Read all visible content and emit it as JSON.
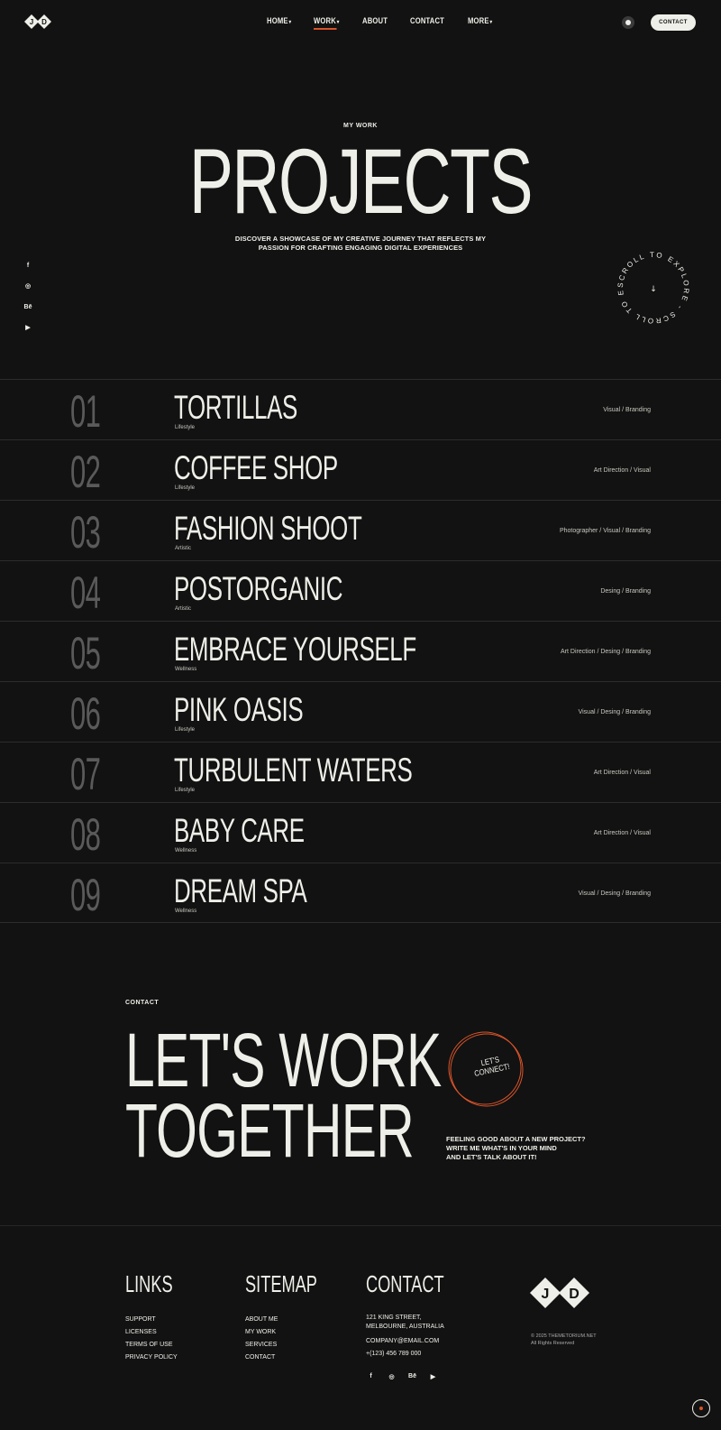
{
  "header": {
    "logo_letters": [
      "J",
      "D"
    ],
    "nav": [
      {
        "label": "HOME",
        "caret": true,
        "active": false
      },
      {
        "label": "WORK",
        "caret": true,
        "active": true
      },
      {
        "label": "ABOUT",
        "caret": false,
        "active": false
      },
      {
        "label": "CONTACT",
        "caret": false,
        "active": false
      },
      {
        "label": "MORE",
        "caret": true,
        "active": false
      }
    ],
    "contact_button": "CONTACT"
  },
  "hero": {
    "eyebrow": "MY WORK",
    "title": "PROJECTS",
    "subtitle_line1": "DISCOVER A SHOWCASE OF MY CREATIVE JOURNEY THAT REFLECTS MY",
    "subtitle_line2": "PASSION FOR CRAFTING ENGAGING DIGITAL EXPERIENCES",
    "scroll_badge_text": "SCROLL TO EXPLORE - SCROLL TO EXPLORE - "
  },
  "social_icons": [
    "f",
    "◎",
    "Bē",
    "▶"
  ],
  "projects": [
    {
      "num": "01",
      "title": "TORTILLAS",
      "category": "Lifestyle",
      "tags": "Visual / Branding"
    },
    {
      "num": "02",
      "title": "COFFEE SHOP",
      "category": "Lifestyle",
      "tags": "Art Direction / Visual"
    },
    {
      "num": "03",
      "title": "FASHION SHOOT",
      "category": "Artistic",
      "tags": "Photographer / Visual / Branding"
    },
    {
      "num": "04",
      "title": "POSTORGANIC",
      "category": "Artistic",
      "tags": "Desing / Branding"
    },
    {
      "num": "05",
      "title": "EMBRACE YOURSELF",
      "category": "Wellness",
      "tags": "Art Direction / Desing / Branding"
    },
    {
      "num": "06",
      "title": "PINK OASIS",
      "category": "Lifestyle",
      "tags": "Visual / Desing / Branding"
    },
    {
      "num": "07",
      "title": "TURBULENT WATERS",
      "category": "Lifestyle",
      "tags": "Art Direction / Visual"
    },
    {
      "num": "08",
      "title": "BABY CARE",
      "category": "Wellness",
      "tags": "Art Direction / Visual"
    },
    {
      "num": "09",
      "title": "DREAM SPA",
      "category": "Wellness",
      "tags": "Visual / Desing / Branding"
    }
  ],
  "contact": {
    "eyebrow": "CONTACT",
    "title_line1": "LET'S WORK",
    "title_line2": "TOGETHER",
    "badge_line1": "LET'S",
    "badge_line2": "CONNECT!",
    "copy_line1": "FEELING GOOD ABOUT A NEW PROJECT?",
    "copy_line2": "WRITE ME WHAT'S IN YOUR MIND",
    "copy_line3": "AND LET'S TALK ABOUT IT!"
  },
  "footer": {
    "links": {
      "heading": "LINKS",
      "items": [
        "SUPPORT",
        "LICENSES",
        "TERMS OF USE",
        "PRIVACY POLICY"
      ]
    },
    "sitemap": {
      "heading": "SITEMAP",
      "items": [
        "ABOUT ME",
        "MY WORK",
        "SERVICES",
        "CONTACT"
      ]
    },
    "contact": {
      "heading": "CONTACT",
      "address_line1": "121 KING STREET,",
      "address_line2": "MELBOURNE, AUSTRALIA",
      "email": "COMPANY@EMAIL.COM",
      "phone": "+(123) 456 789 000"
    },
    "copyright_line1": "© 2025 THEMETORIUM.NET",
    "copyright_line2": "All Rights Reserved"
  },
  "colors": {
    "background": "#121212",
    "text": "#efefe9",
    "accent": "#d8542a",
    "muted_number": "#5a5a5a"
  }
}
